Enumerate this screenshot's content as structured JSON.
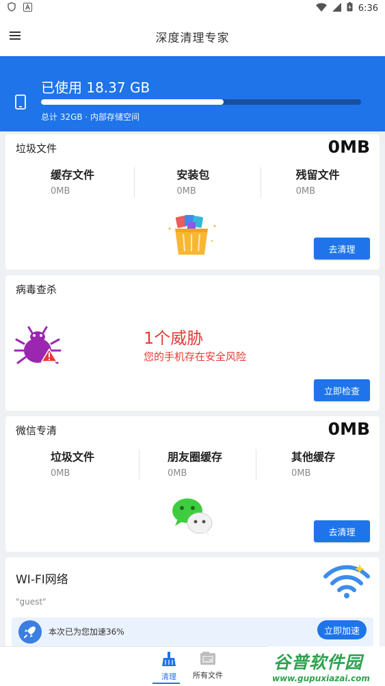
{
  "status_bar": {
    "time": "6:36"
  },
  "app_bar": {
    "title": "深度清理专家"
  },
  "storage": {
    "used_label": "已使用 18.37 GB",
    "used_fraction": 0.57,
    "total_label": "总计 32GB · 内部存储空间"
  },
  "junk": {
    "title": "垃圾文件",
    "total": "0MB",
    "items": [
      {
        "label": "缓存文件",
        "value": "0MB"
      },
      {
        "label": "安装包",
        "value": "0MB"
      },
      {
        "label": "残留文件",
        "value": "0MB"
      }
    ],
    "button": "去清理"
  },
  "virus": {
    "title": "病毒查杀",
    "threat_count": "1个威胁",
    "threat_desc": "您的手机存在安全风险",
    "button": "立即检查"
  },
  "wechat": {
    "title": "微信专清",
    "total": "0MB",
    "items": [
      {
        "label": "垃圾文件",
        "value": "0MB"
      },
      {
        "label": "朋友圈缓存",
        "value": "0MB"
      },
      {
        "label": "其他缓存",
        "value": "0MB"
      }
    ],
    "button": "去清理"
  },
  "wifi": {
    "title": "WI-FI网络",
    "network": "\"guest\"",
    "boost_text": "本次已为您加速36%",
    "boost_button": "立即加速"
  },
  "bottom_nav": [
    {
      "label": "清理"
    },
    {
      "label": "所有文件"
    }
  ],
  "watermark": {
    "title": "谷普软件园",
    "url": "www.gupuxiazai.com"
  },
  "colors": {
    "accent": "#1e74e8",
    "danger": "#e53935",
    "wechat": "#3fcd3f",
    "watermark": "#2ea14e"
  }
}
